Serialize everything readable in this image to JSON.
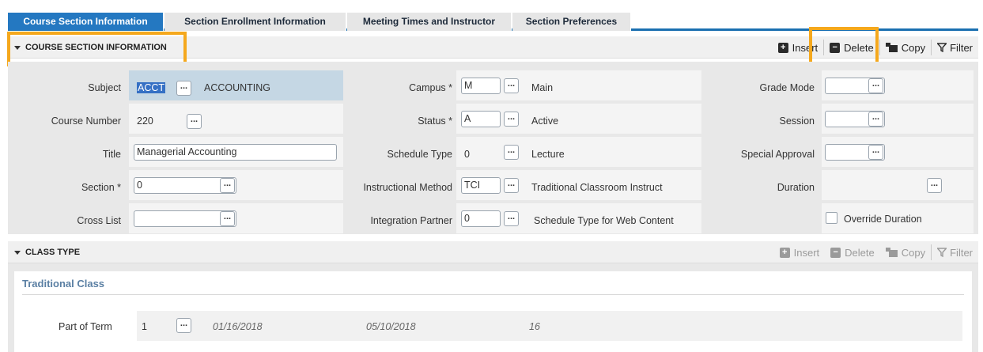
{
  "tabs": [
    "Course Section Information",
    "Section Enrollment Information",
    "Meeting Times and Instructor",
    "Section Preferences"
  ],
  "section1": {
    "title": "COURSE SECTION INFORMATION",
    "toolbar": {
      "insert": "Insert",
      "delete": "Delete",
      "copy": "Copy",
      "filter": "Filter"
    }
  },
  "form": {
    "subject": {
      "label": "Subject",
      "value": "ACCT",
      "desc": "ACCOUNTING"
    },
    "course_number": {
      "label": "Course Number",
      "value": "220"
    },
    "title": {
      "label": "Title",
      "value": "Managerial Accounting"
    },
    "section": {
      "label": "Section *",
      "value": "0"
    },
    "cross_list": {
      "label": "Cross List",
      "value": ""
    },
    "campus": {
      "label": "Campus *",
      "value": "M",
      "desc": "Main"
    },
    "status": {
      "label": "Status *",
      "value": "A",
      "desc": "Active"
    },
    "schedule_type": {
      "label": "Schedule Type",
      "value": "0",
      "desc": "Lecture"
    },
    "instructional_method": {
      "label": "Instructional Method",
      "value": "TCI",
      "desc": "Traditional Classroom Instruct"
    },
    "integration_partner": {
      "label": "Integration Partner",
      "value": "0",
      "desc": "Schedule Type for Web Content"
    },
    "grade_mode": {
      "label": "Grade Mode",
      "value": ""
    },
    "session": {
      "label": "Session",
      "value": ""
    },
    "special_approval": {
      "label": "Special Approval",
      "value": ""
    },
    "duration": {
      "label": "Duration"
    },
    "override_duration": {
      "label": "Override Duration",
      "checked": false
    }
  },
  "lookup_glyph": "...",
  "section2": {
    "title": "CLASS TYPE",
    "toolbar": {
      "insert": "Insert",
      "delete": "Delete",
      "copy": "Copy",
      "filter": "Filter"
    },
    "card_title": "Traditional Class",
    "part_of_term": {
      "label": "Part of Term",
      "value": "1",
      "start": "01/16/2018",
      "end": "05/10/2018",
      "weeks": "16"
    }
  },
  "colors": {
    "tab_active": "#2478c1",
    "highlight": "#f5a81d",
    "title_blue": "#5a7fa3"
  }
}
